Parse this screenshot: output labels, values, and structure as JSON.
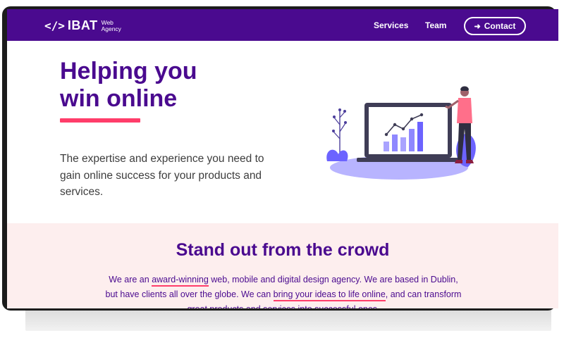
{
  "nav": {
    "logo_code": "</>",
    "logo_name": "IBAT",
    "logo_sub_1": "Web",
    "logo_sub_2": "Agency",
    "links": [
      "Services",
      "Team"
    ],
    "contact_label": "Contact",
    "contact_icon": "arrow-right-icon",
    "background": "#4a0a8f"
  },
  "hero": {
    "title_line1": "Helping you",
    "title_line2": "win online",
    "text": "The expertise and experience you need to gain online success for your products and services.",
    "title_color": "#4a0a8f",
    "accent_color": "#ff3d6a"
  },
  "band": {
    "title": "Stand out from the crowd",
    "text_1": "We are an ",
    "highlight_1": "award-winning",
    "text_2": " web, mobile and digital design agency. We are based in Dublin, but have clients all over the globe. We can ",
    "highlight_2": "bring your ideas to life online",
    "text_3": ", and can transform great products and services into successful ones.",
    "background": "#fdeeee"
  }
}
